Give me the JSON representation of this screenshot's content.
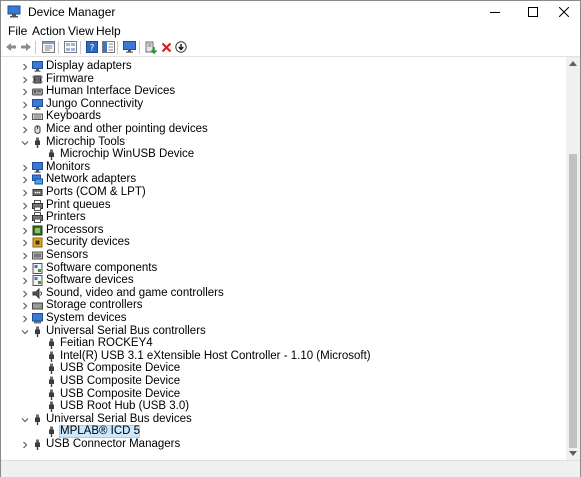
{
  "window": {
    "title": "Device Manager"
  },
  "menu": [
    "File",
    "Action",
    "View",
    "Help"
  ],
  "tree": [
    {
      "label": "Display adapters",
      "icon": "monitor-icon",
      "level": 0,
      "expander": "collapsed"
    },
    {
      "label": "Firmware",
      "icon": "chip-icon",
      "level": 0,
      "expander": "collapsed"
    },
    {
      "label": "Human Interface Devices",
      "icon": "hid-icon",
      "level": 0,
      "expander": "collapsed"
    },
    {
      "label": "Jungo Connectivity",
      "icon": "monitor-icon",
      "level": 0,
      "expander": "collapsed"
    },
    {
      "label": "Keyboards",
      "icon": "keyboard-icon",
      "level": 0,
      "expander": "collapsed"
    },
    {
      "label": "Mice and other pointing devices",
      "icon": "mouse-icon",
      "level": 0,
      "expander": "collapsed"
    },
    {
      "label": "Microchip Tools",
      "icon": "usb-plug-icon",
      "level": 0,
      "expander": "expanded"
    },
    {
      "label": "Microchip WinUSB Device",
      "icon": "usb-plug-icon",
      "level": 1,
      "expander": "none"
    },
    {
      "label": "Monitors",
      "icon": "monitor-icon",
      "level": 0,
      "expander": "collapsed"
    },
    {
      "label": "Network adapters",
      "icon": "network-icon",
      "level": 0,
      "expander": "collapsed"
    },
    {
      "label": "Ports (COM & LPT)",
      "icon": "port-icon",
      "level": 0,
      "expander": "collapsed"
    },
    {
      "label": "Print queues",
      "icon": "printer-icon",
      "level": 0,
      "expander": "collapsed"
    },
    {
      "label": "Printers",
      "icon": "printer-icon",
      "level": 0,
      "expander": "collapsed"
    },
    {
      "label": "Processors",
      "icon": "processor-icon",
      "level": 0,
      "expander": "collapsed"
    },
    {
      "label": "Security devices",
      "icon": "security-icon",
      "level": 0,
      "expander": "collapsed"
    },
    {
      "label": "Sensors",
      "icon": "sensor-icon",
      "level": 0,
      "expander": "collapsed"
    },
    {
      "label": "Software components",
      "icon": "software-icon",
      "level": 0,
      "expander": "collapsed"
    },
    {
      "label": "Software devices",
      "icon": "software-icon",
      "level": 0,
      "expander": "collapsed"
    },
    {
      "label": "Sound, video and game controllers",
      "icon": "speaker-icon",
      "level": 0,
      "expander": "collapsed"
    },
    {
      "label": "Storage controllers",
      "icon": "storage-icon",
      "level": 0,
      "expander": "collapsed"
    },
    {
      "label": "System devices",
      "icon": "system-icon",
      "level": 0,
      "expander": "collapsed"
    },
    {
      "label": "Universal Serial Bus controllers",
      "icon": "usb-plug-icon",
      "level": 0,
      "expander": "expanded"
    },
    {
      "label": "Feitian ROCKEY4",
      "icon": "usb-plug-icon",
      "level": 1,
      "expander": "none"
    },
    {
      "label": "Intel(R) USB 3.1 eXtensible Host Controller - 1.10 (Microsoft)",
      "icon": "usb-plug-icon",
      "level": 1,
      "expander": "none"
    },
    {
      "label": "USB Composite Device",
      "icon": "usb-plug-icon",
      "level": 1,
      "expander": "none"
    },
    {
      "label": "USB Composite Device",
      "icon": "usb-plug-icon",
      "level": 1,
      "expander": "none"
    },
    {
      "label": "USB Composite Device",
      "icon": "usb-plug-icon",
      "level": 1,
      "expander": "none"
    },
    {
      "label": "USB Root Hub (USB 3.0)",
      "icon": "usb-plug-icon",
      "level": 1,
      "expander": "none"
    },
    {
      "label": "Universal Serial Bus devices",
      "icon": "usb-plug-icon",
      "level": 0,
      "expander": "expanded"
    },
    {
      "label": "MPLAB® ICD 5",
      "icon": "usb-plug-icon",
      "level": 1,
      "expander": "none",
      "selected": true
    },
    {
      "label": "USB Connector Managers",
      "icon": "usb-plug-icon",
      "level": 0,
      "expander": "collapsed"
    }
  ],
  "colors": {
    "selection_fill": "#cce8ff",
    "selection_border": "#99d1ff",
    "remove_red": "#d81e1e"
  }
}
